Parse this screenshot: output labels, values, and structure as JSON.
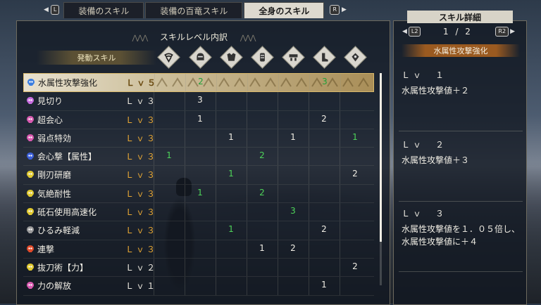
{
  "tabs": {
    "prev_button": "L",
    "next_button": "R",
    "items": [
      "装備のスキル",
      "装備の百竜スキル",
      "全身のスキル"
    ],
    "active_index": 2
  },
  "breakdown": {
    "title": "スキルレベル内訳",
    "title_deco": "⋀⋀⋀",
    "active_header": "発動スキル",
    "equipment_icons": [
      "weapon-icon",
      "helm-icon",
      "chest-icon",
      "arms-icon",
      "waist-icon",
      "legs-icon",
      "talisman-icon"
    ]
  },
  "skills": [
    {
      "name": "水属性攻撃強化",
      "level": "Ｌｖ５",
      "color": "#3b7ee0",
      "lv_color": "orange",
      "cells": [
        "",
        "2",
        "",
        "",
        "",
        "3",
        ""
      ],
      "green": [
        false,
        true,
        false,
        false,
        false,
        true,
        false
      ],
      "selected": true
    },
    {
      "name": "見切り",
      "level": "Ｌｖ３",
      "color": "#c76de0",
      "lv_color": "white",
      "cells": [
        "",
        "3",
        "",
        "",
        "",
        "",
        ""
      ],
      "green": [
        false,
        false,
        false,
        false,
        false,
        false,
        false
      ]
    },
    {
      "name": "超会心",
      "level": "Ｌｖ３",
      "color": "#d85ab0",
      "lv_color": "orange",
      "cells": [
        "",
        "1",
        "",
        "",
        "",
        "2",
        ""
      ],
      "green": [
        false,
        false,
        false,
        false,
        false,
        false,
        false
      ]
    },
    {
      "name": "弱点特効",
      "level": "Ｌｖ３",
      "color": "#d85ab0",
      "lv_color": "orange",
      "cells": [
        "",
        "",
        "1",
        "",
        "1",
        "",
        "1"
      ],
      "green": [
        false,
        false,
        false,
        false,
        false,
        false,
        true
      ]
    },
    {
      "name": "会心撃【属性】",
      "level": "Ｌｖ３",
      "color": "#3b5fd8",
      "lv_color": "orange",
      "cells": [
        "1",
        "",
        "",
        "2",
        "",
        "",
        ""
      ],
      "green": [
        true,
        false,
        false,
        true,
        false,
        false,
        false
      ]
    },
    {
      "name": "剛刃研磨",
      "level": "Ｌｖ３",
      "color": "#e0c930",
      "lv_color": "orange",
      "cells": [
        "",
        "",
        "1",
        "",
        "",
        "",
        "2"
      ],
      "green": [
        false,
        false,
        true,
        false,
        false,
        false,
        false
      ]
    },
    {
      "name": "気絶耐性",
      "level": "Ｌｖ３",
      "color": "#e0c930",
      "lv_color": "orange",
      "cells": [
        "",
        "1",
        "",
        "2",
        "",
        "",
        ""
      ],
      "green": [
        false,
        true,
        false,
        true,
        false,
        false,
        false
      ]
    },
    {
      "name": "砥石使用高速化",
      "level": "Ｌｖ３",
      "color": "#e0c930",
      "lv_color": "orange",
      "cells": [
        "",
        "",
        "",
        "",
        "3",
        "",
        ""
      ],
      "green": [
        false,
        false,
        false,
        false,
        true,
        false,
        false
      ]
    },
    {
      "name": "ひるみ軽減",
      "level": "Ｌｖ３",
      "color": "#9a9a9a",
      "lv_color": "orange",
      "cells": [
        "",
        "",
        "1",
        "",
        "",
        "2",
        ""
      ],
      "green": [
        false,
        false,
        true,
        false,
        false,
        false,
        false
      ]
    },
    {
      "name": "連撃",
      "level": "Ｌｖ３",
      "color": "#e04a2a",
      "lv_color": "orange",
      "cells": [
        "",
        "",
        "",
        "1",
        "2",
        "",
        ""
      ],
      "green": [
        false,
        false,
        false,
        false,
        false,
        false,
        false
      ]
    },
    {
      "name": "抜刀術【力】",
      "level": "Ｌｖ２",
      "color": "#e0c930",
      "lv_color": "white",
      "cells": [
        "",
        "",
        "",
        "",
        "",
        "",
        "2"
      ],
      "green": [
        false,
        false,
        false,
        false,
        false,
        false,
        false
      ]
    },
    {
      "name": "力の解放",
      "level": "Ｌｖ１",
      "color": "#d85ab0",
      "lv_color": "white",
      "cells": [
        "",
        "",
        "",
        "",
        "",
        "1",
        ""
      ],
      "green": [
        false,
        false,
        false,
        false,
        false,
        false,
        false
      ]
    }
  ],
  "detail": {
    "title": "スキル詳細",
    "page_prev_button": "L2",
    "page_next_button": "R2",
    "page": "1 / 2",
    "skill_name": "水属性攻撃強化",
    "levels": [
      {
        "lv": "Ｌｖ　１",
        "desc": "水属性攻撃値＋２"
      },
      {
        "lv": "Ｌｖ　２",
        "desc": "水属性攻撃値＋３"
      },
      {
        "lv": "Ｌｖ　３",
        "desc": "水属性攻撃値を１．０５倍し、水属性攻撃値に＋４"
      }
    ]
  }
}
